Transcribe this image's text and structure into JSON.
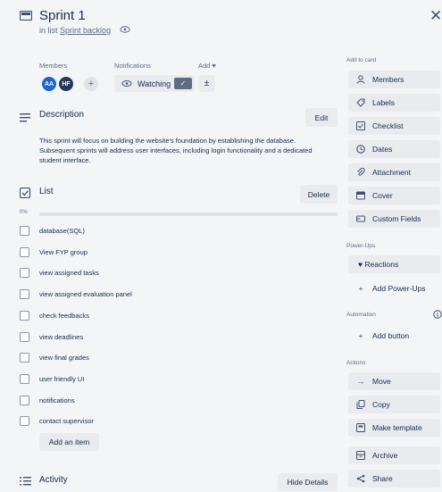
{
  "card": {
    "title": "Sprint 1",
    "in_list_prefix": "in list",
    "list_name": "Sprint backlog"
  },
  "header_labels": {
    "members": "Members",
    "notifications": "Notifications",
    "add": "Add ♥"
  },
  "members": [
    {
      "initials": "AA",
      "color": "#1d64d8"
    },
    {
      "initials": "HF",
      "color": "#253858"
    }
  ],
  "notifications": {
    "watch_label": "Watching"
  },
  "description": {
    "heading": "Description",
    "edit_label": "Edit",
    "text": "This sprint will focus on building the website's foundation by establishing the database. Subsequent sprints will address user interfaces, including login functionality and a dedicated student interface."
  },
  "checklist": {
    "heading": "List",
    "delete_label": "Delete",
    "progress_label": "0%",
    "progress_fraction": 0,
    "items": [
      "database(SQL)",
      "View FYP group",
      "view assigned tasks",
      "view assigned evaluation panel",
      "check feedbacks",
      "view deadlines",
      "view final grades",
      "user friendly UI",
      "notifications",
      "contact supervisor"
    ],
    "add_item_label": "Add an item"
  },
  "activity": {
    "heading": "Activity",
    "hide_details_label": "Hide Details"
  },
  "sidebar": {
    "add_to_card_heading": "Add to card",
    "add_to_card": [
      {
        "label": "Members",
        "icon": "person-icon"
      },
      {
        "label": "Labels",
        "icon": "tag-icon"
      },
      {
        "label": "Checklist",
        "icon": "checklist-icon"
      },
      {
        "label": "Dates",
        "icon": "clock-icon"
      },
      {
        "label": "Attachment",
        "icon": "paperclip-icon"
      },
      {
        "label": "Cover",
        "icon": "cover-icon"
      },
      {
        "label": "Custom Fields",
        "icon": "custom-fields-icon"
      }
    ],
    "powerups_heading": "Power-Ups",
    "reactions_label": "♥ Reactions",
    "add_powerups_label": "Add Power-Ups",
    "automation_heading": "Automation",
    "add_button_label": "Add button",
    "actions_heading": "Actions",
    "actions": [
      {
        "label": "Move",
        "icon": "arrow-right-icon"
      },
      {
        "label": "Copy",
        "icon": "copy-icon"
      },
      {
        "label": "Make template",
        "icon": "template-icon"
      },
      {
        "label": "Archive",
        "icon": "archive-icon"
      },
      {
        "label": "Share",
        "icon": "share-icon"
      }
    ]
  },
  "colors": {
    "background": "#f4f5f7",
    "button_bg": "#e9ebee",
    "text": "#172b4d",
    "muted": "#5e6c84",
    "progress_track": "#dfe1e6"
  }
}
